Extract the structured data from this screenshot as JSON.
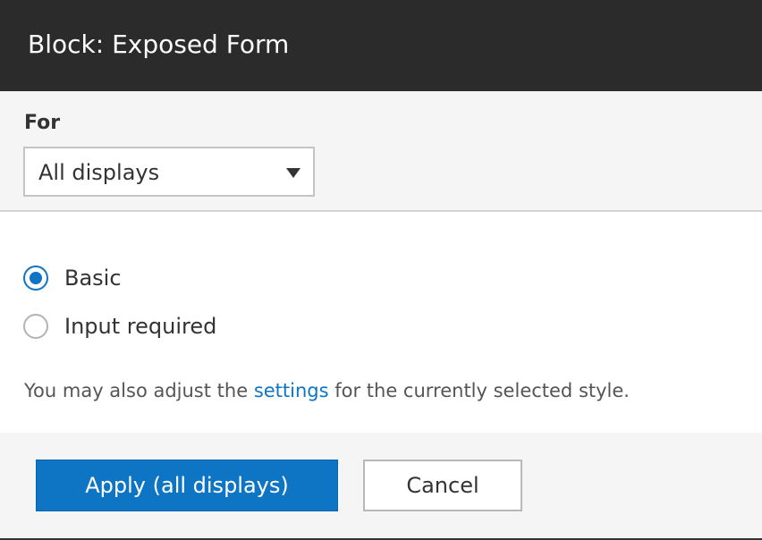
{
  "dialog": {
    "title": "Block: Exposed Form"
  },
  "for_field": {
    "label": "For",
    "selected": "All displays"
  },
  "style_options": [
    {
      "label": "Basic",
      "checked": true
    },
    {
      "label": "Input required",
      "checked": false
    }
  ],
  "description": {
    "before": "You may also adjust the ",
    "link": "settings",
    "after": " for the currently selected style."
  },
  "actions": {
    "apply_label": "Apply (all displays)",
    "cancel_label": "Cancel"
  },
  "colors": {
    "accent": "#0e75c5",
    "titlebar": "#2b2b2b"
  },
  "icons": {
    "select_caret": "triangle-down",
    "radio": "circle"
  }
}
